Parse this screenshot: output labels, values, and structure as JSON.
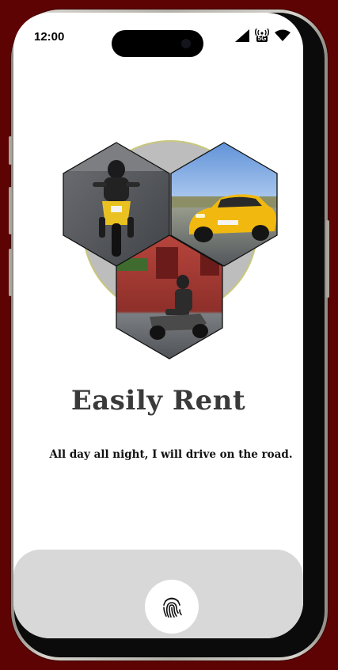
{
  "status_bar": {
    "time": "12:00",
    "network_label": "5G"
  },
  "hero": {
    "tiles": [
      {
        "id": "motorbike",
        "icon": "motorbike-rider-photo"
      },
      {
        "id": "sports-car",
        "icon": "sports-car-photo"
      },
      {
        "id": "scooter",
        "icon": "scooter-rider-photo"
      }
    ],
    "circle_color": "#bdbdbd",
    "circle_ring_color": "#c9c77a"
  },
  "content": {
    "title": "Easily Rent",
    "subtitle": "All day all night, I will drive on the road."
  },
  "action": {
    "icon": "fingerprint-icon"
  },
  "colors": {
    "background": "#5e0303",
    "screen": "#ffffff",
    "panel": "#d8d8d8",
    "title": "#3a3a3a"
  }
}
